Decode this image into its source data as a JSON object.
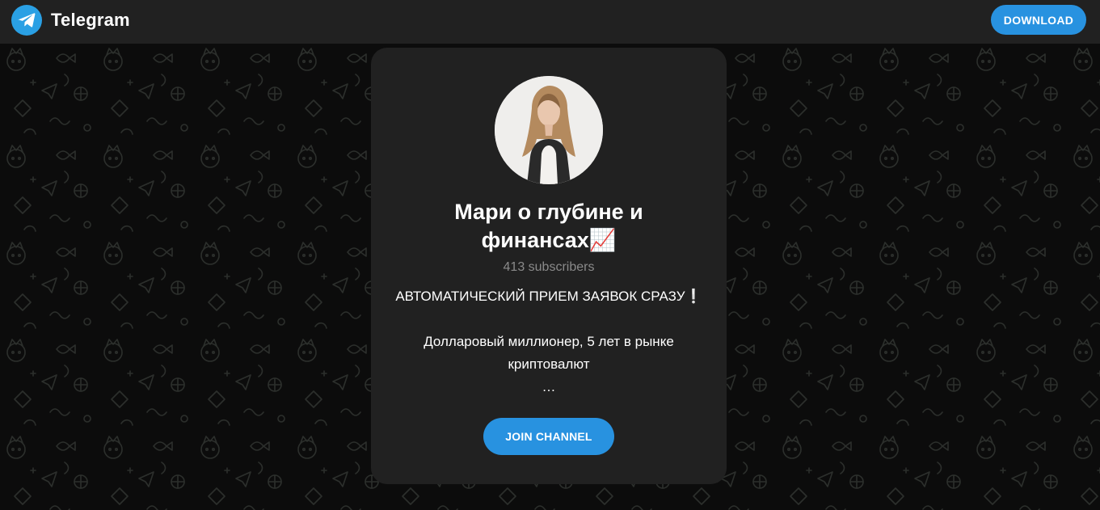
{
  "header": {
    "brand": "Telegram",
    "download_label": "DOWNLOAD"
  },
  "channel": {
    "title": "Мари о глубине и финансах📈",
    "subscribers": "413 subscribers",
    "description_line1": "АВТОМАТИЧЕСКИЙ ПРИЕМ ЗАЯВОК СРАЗУ❕",
    "description_line2": "Долларовый миллионер, 5 лет в рынке криптовалют",
    "description_more": "…",
    "join_label": "JOIN CHANNEL"
  },
  "colors": {
    "accent": "#2892e0",
    "header_bg": "#212121",
    "card_bg": "#212121",
    "page_bg": "#0e0e0e"
  },
  "icons": {
    "logo": "telegram-paper-plane-icon"
  }
}
